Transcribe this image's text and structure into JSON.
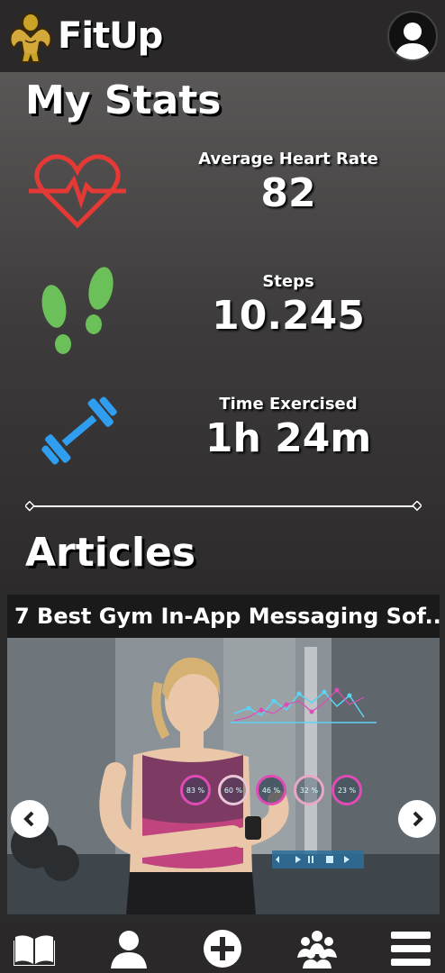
{
  "app": {
    "name": "FitUp"
  },
  "stats": {
    "title": "My Stats",
    "items": [
      {
        "label": "Average Heart Rate",
        "value": "82",
        "icon": "heart-rate-icon",
        "color": "#e53935"
      },
      {
        "label": "Steps",
        "value": "10.245",
        "icon": "footsteps-icon",
        "color": "#6cc05a"
      },
      {
        "label": "Time Exercised",
        "value": "1h 24m",
        "icon": "dumbbell-icon",
        "color": "#2f9df0"
      }
    ]
  },
  "articles": {
    "title": "Articles",
    "current": {
      "title": "7 Best Gym In-App Messaging Sof...",
      "overlay_percents": [
        "83 %",
        "60 %",
        "46 %",
        "32 %",
        "23 %"
      ]
    }
  },
  "nav": {
    "items": [
      "book-icon",
      "profile-icon",
      "add-icon",
      "community-icon",
      "menu-icon"
    ]
  }
}
